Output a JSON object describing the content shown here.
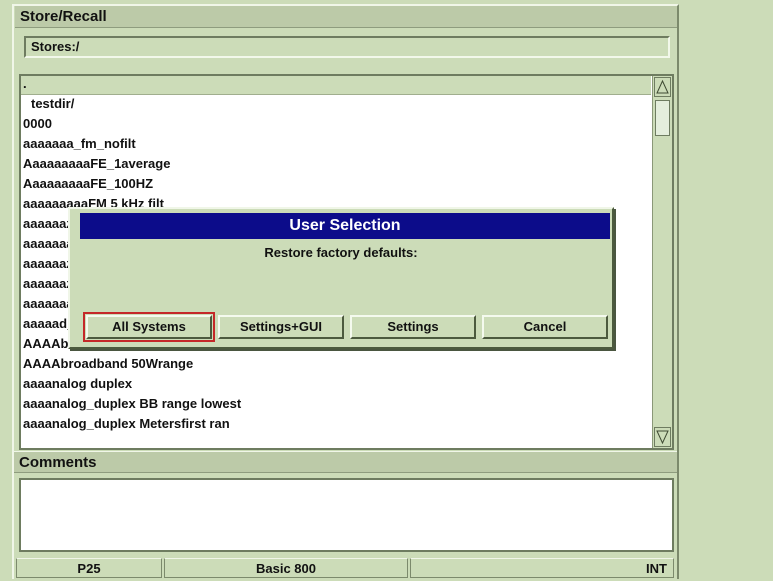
{
  "window": {
    "title": "Store/Recall"
  },
  "path": {
    "value": "Stores:/"
  },
  "file_list": {
    "items": [
      ".",
      "  testdir/",
      "0000",
      "aaaaaaa_fm_nofilt",
      "AaaaaaaaaFE_1average",
      "AaaaaaaaaFE_100HZ",
      "aaaaaaaaaFM 5 kHz filt",
      "aaaaaaz",
      "aaaaaaa",
      "aaaaaaz",
      "aaaaaaz",
      "aaaaaaa",
      "aaaaad_",
      "AAAAbroadband 50W range",
      "AAAAbroadband 50Wrange",
      "aaaanalog duplex",
      "aaaanalog_duplex BB range lowest",
      "aaaanalog_duplex Metersfirst ran"
    ]
  },
  "comments": {
    "label": "Comments",
    "value": ""
  },
  "status": {
    "left": "P25",
    "middle": "Basic 800",
    "right": "INT"
  },
  "dialog": {
    "title": "User Selection",
    "message": "Restore factory defaults:",
    "buttons": [
      "All Systems",
      "Settings+GUI",
      "Settings",
      "Cancel"
    ]
  },
  "colors": {
    "background": "#ccdcb8",
    "dialog_title_bg": "#0c0c8a",
    "focus_outline": "#c42828"
  },
  "icons": {
    "scroll_up": "triangle-up-icon",
    "scroll_down": "triangle-down-icon"
  }
}
